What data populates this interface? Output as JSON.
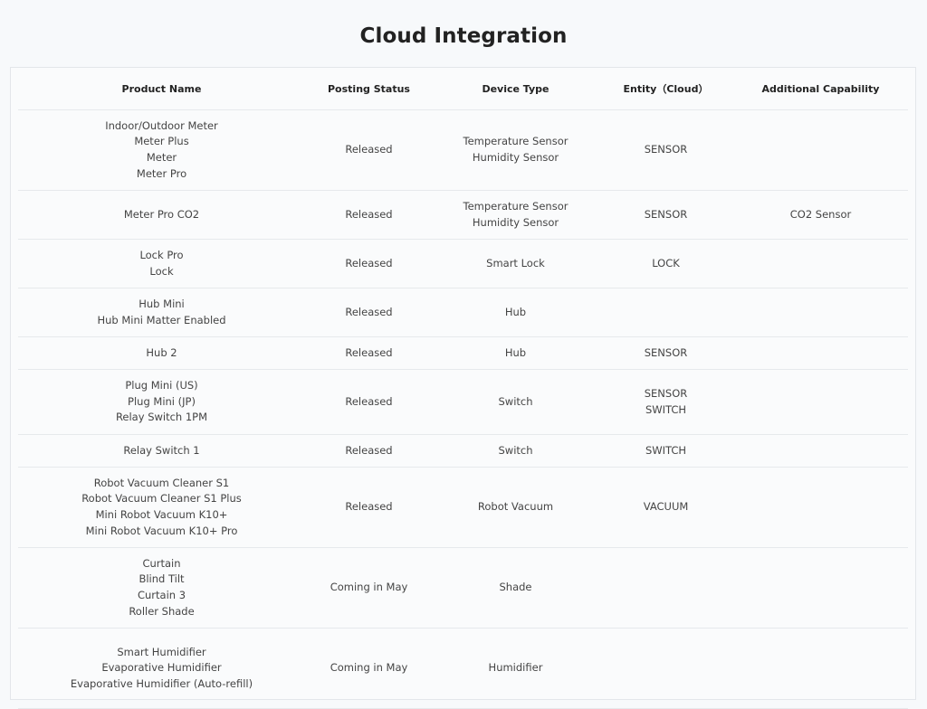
{
  "page": {
    "title": "Cloud Integration"
  },
  "table": {
    "headers": [
      "Product Name",
      "Posting Status",
      "Device Type",
      "Entity（Cloud）",
      "Additional Capability"
    ],
    "rows": [
      {
        "products": [
          "Indoor/Outdoor Meter",
          "Meter Plus",
          "Meter",
          "Meter Pro"
        ],
        "status": "Released",
        "device_types": [
          "Temperature Sensor",
          "Humidity Sensor"
        ],
        "entities": [
          "SENSOR"
        ],
        "capability": ""
      },
      {
        "products": [
          "Meter Pro CO2"
        ],
        "status": "Released",
        "device_types": [
          "Temperature Sensor",
          "Humidity Sensor"
        ],
        "entities": [
          "SENSOR"
        ],
        "capability": "CO2 Sensor"
      },
      {
        "products": [
          "Lock Pro",
          "Lock"
        ],
        "status": "Released",
        "device_types": [
          "Smart Lock"
        ],
        "entities": [
          "LOCK"
        ],
        "capability": ""
      },
      {
        "products": [
          "Hub Mini",
          "Hub Mini Matter Enabled"
        ],
        "status": "Released",
        "device_types": [
          "Hub"
        ],
        "entities": [],
        "capability": ""
      },
      {
        "products": [
          "Hub 2"
        ],
        "status": "Released",
        "device_types": [
          "Hub"
        ],
        "entities": [
          "SENSOR"
        ],
        "capability": ""
      },
      {
        "products": [
          "Plug Mini (US)",
          "Plug Mini (JP)",
          "Relay Switch 1PM"
        ],
        "status": "Released",
        "device_types": [
          "Switch"
        ],
        "entities": [
          "SENSOR",
          "SWITCH"
        ],
        "capability": ""
      },
      {
        "products": [
          "Relay Switch 1"
        ],
        "status": "Released",
        "device_types": [
          "Switch"
        ],
        "entities": [
          "SWITCH"
        ],
        "capability": ""
      },
      {
        "products": [
          "Robot Vacuum Cleaner S1",
          "Robot Vacuum Cleaner S1 Plus",
          "Mini Robot Vacuum K10+",
          "Mini Robot Vacuum K10+ Pro"
        ],
        "status": "Released",
        "device_types": [
          "Robot Vacuum"
        ],
        "entities": [
          "VACUUM"
        ],
        "capability": ""
      },
      {
        "products": [
          "Curtain",
          "Blind Tilt",
          "Curtain 3",
          "Roller Shade"
        ],
        "status": "Coming in May",
        "device_types": [
          "Shade"
        ],
        "entities": [],
        "capability": ""
      },
      {
        "products": [
          "Smart Humidifier",
          "Evaporative Humidifier",
          "Evaporative Humidifier (Auto-refill)"
        ],
        "status": "Coming in May",
        "device_types": [
          "Humidifier"
        ],
        "entities": [],
        "capability": ""
      }
    ]
  }
}
